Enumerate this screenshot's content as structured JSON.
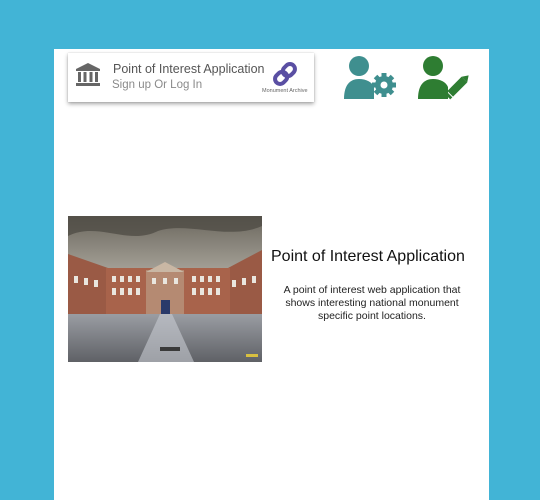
{
  "header": {
    "title": "Point of Interest Application",
    "subtitle": "Sign up Or Log In",
    "logo_icon": "bank-icon",
    "archive_icon": "link-icon",
    "archive_label": "Monument Archive"
  },
  "toolbar": {
    "settings_icon": "user-cog-icon",
    "edit_icon": "user-edit-icon"
  },
  "hero": {
    "image_alt": "courtyard-building-photo",
    "title": "Point of Interest Application",
    "description": "A point of interest web application that shows interesting national monument specific point locations."
  },
  "colors": {
    "background": "#42b4d6",
    "bank_icon": "#666666",
    "link_icon": "#5a4fa3",
    "user_cog_icon": "#3f8f8f",
    "user_edit_icon": "#2e7d32"
  }
}
